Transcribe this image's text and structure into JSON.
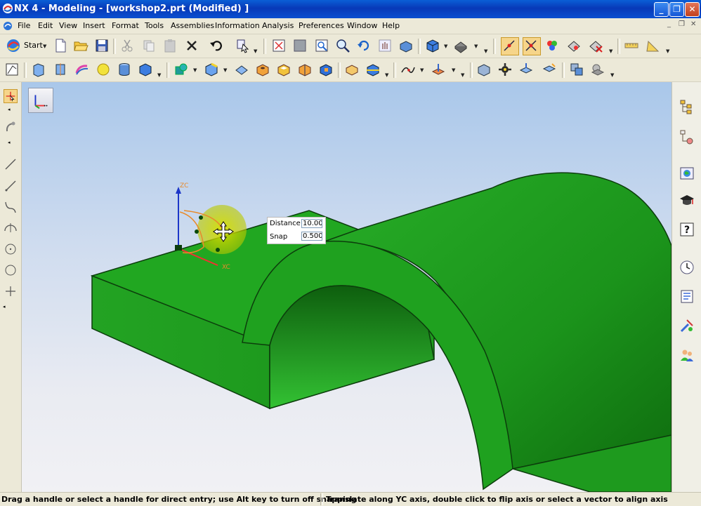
{
  "window": {
    "title": "NX 4 - Modeling - [workshop2.prt (Modified) ]",
    "controls": [
      "_",
      "❐",
      "✕"
    ]
  },
  "menubar": {
    "items": [
      "File",
      "Edit",
      "View",
      "Insert",
      "Format",
      "Tools",
      "Assemblies",
      "Information",
      "Analysis",
      "Preferences",
      "Window",
      "Help"
    ],
    "mdi_controls": [
      "_",
      "❐",
      "✕"
    ]
  },
  "toolbar": {
    "start_label": "Start"
  },
  "viewport": {
    "axis_labels": {
      "zc": "ZC",
      "xc": "XC"
    },
    "dimension_panel": {
      "distance_label": "Distance",
      "distance_value": "10.00",
      "snap_label": "Snap",
      "snap_value": "0.500"
    }
  },
  "colors": {
    "model_top": "#1fa51f",
    "model_front": "#1b9a1b",
    "model_inner": "#2bb52b",
    "model_edge": "#0c3d0c",
    "handle_highlight": "#c9d400"
  },
  "statusbar": {
    "left": "Drag a handle or select a handle for direct entry; use Alt key to turn off snapping",
    "right": "Translate along YC axis, double click to flip axis or select a vector to align axis"
  }
}
